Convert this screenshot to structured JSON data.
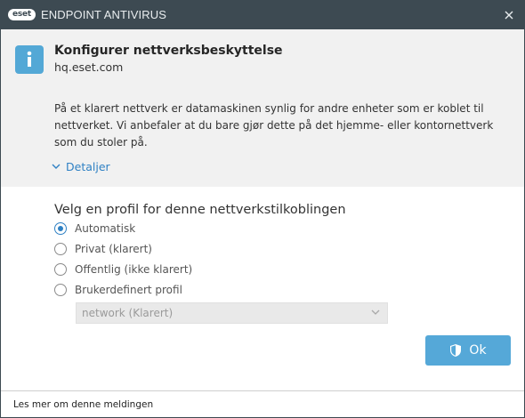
{
  "window": {
    "brand": "eset",
    "title": "ENDPOINT ANTIVIRUS"
  },
  "header": {
    "title": "Konfigurer nettverksbeskyttelse",
    "subtitle": "hq.eset.com",
    "description": "På et klarert nettverk er datamaskinen synlig for andre enheter som er koblet til nettverket. Vi anbefaler at du bare gjør dette på det hjemme- eller kontornettverk som du stoler på.",
    "details_label": "Detaljer"
  },
  "profile": {
    "heading": "Velg en profil for denne nettverkstilkoblingen",
    "options": [
      {
        "label": "Automatisk",
        "checked": true
      },
      {
        "label": "Privat (klarert)",
        "checked": false
      },
      {
        "label": "Offentlig (ikke klarert)",
        "checked": false
      },
      {
        "label": "Brukerdefinert profil",
        "checked": false
      }
    ],
    "custom_select_value": "network (Klarert)"
  },
  "actions": {
    "ok_label": "Ok"
  },
  "footer": {
    "link_label": "Les mer om denne meldingen"
  },
  "colors": {
    "titlebar": "#3d4a52",
    "accent": "#2f81c4",
    "button": "#55a8d8",
    "header_bg": "#f1f1f1"
  }
}
